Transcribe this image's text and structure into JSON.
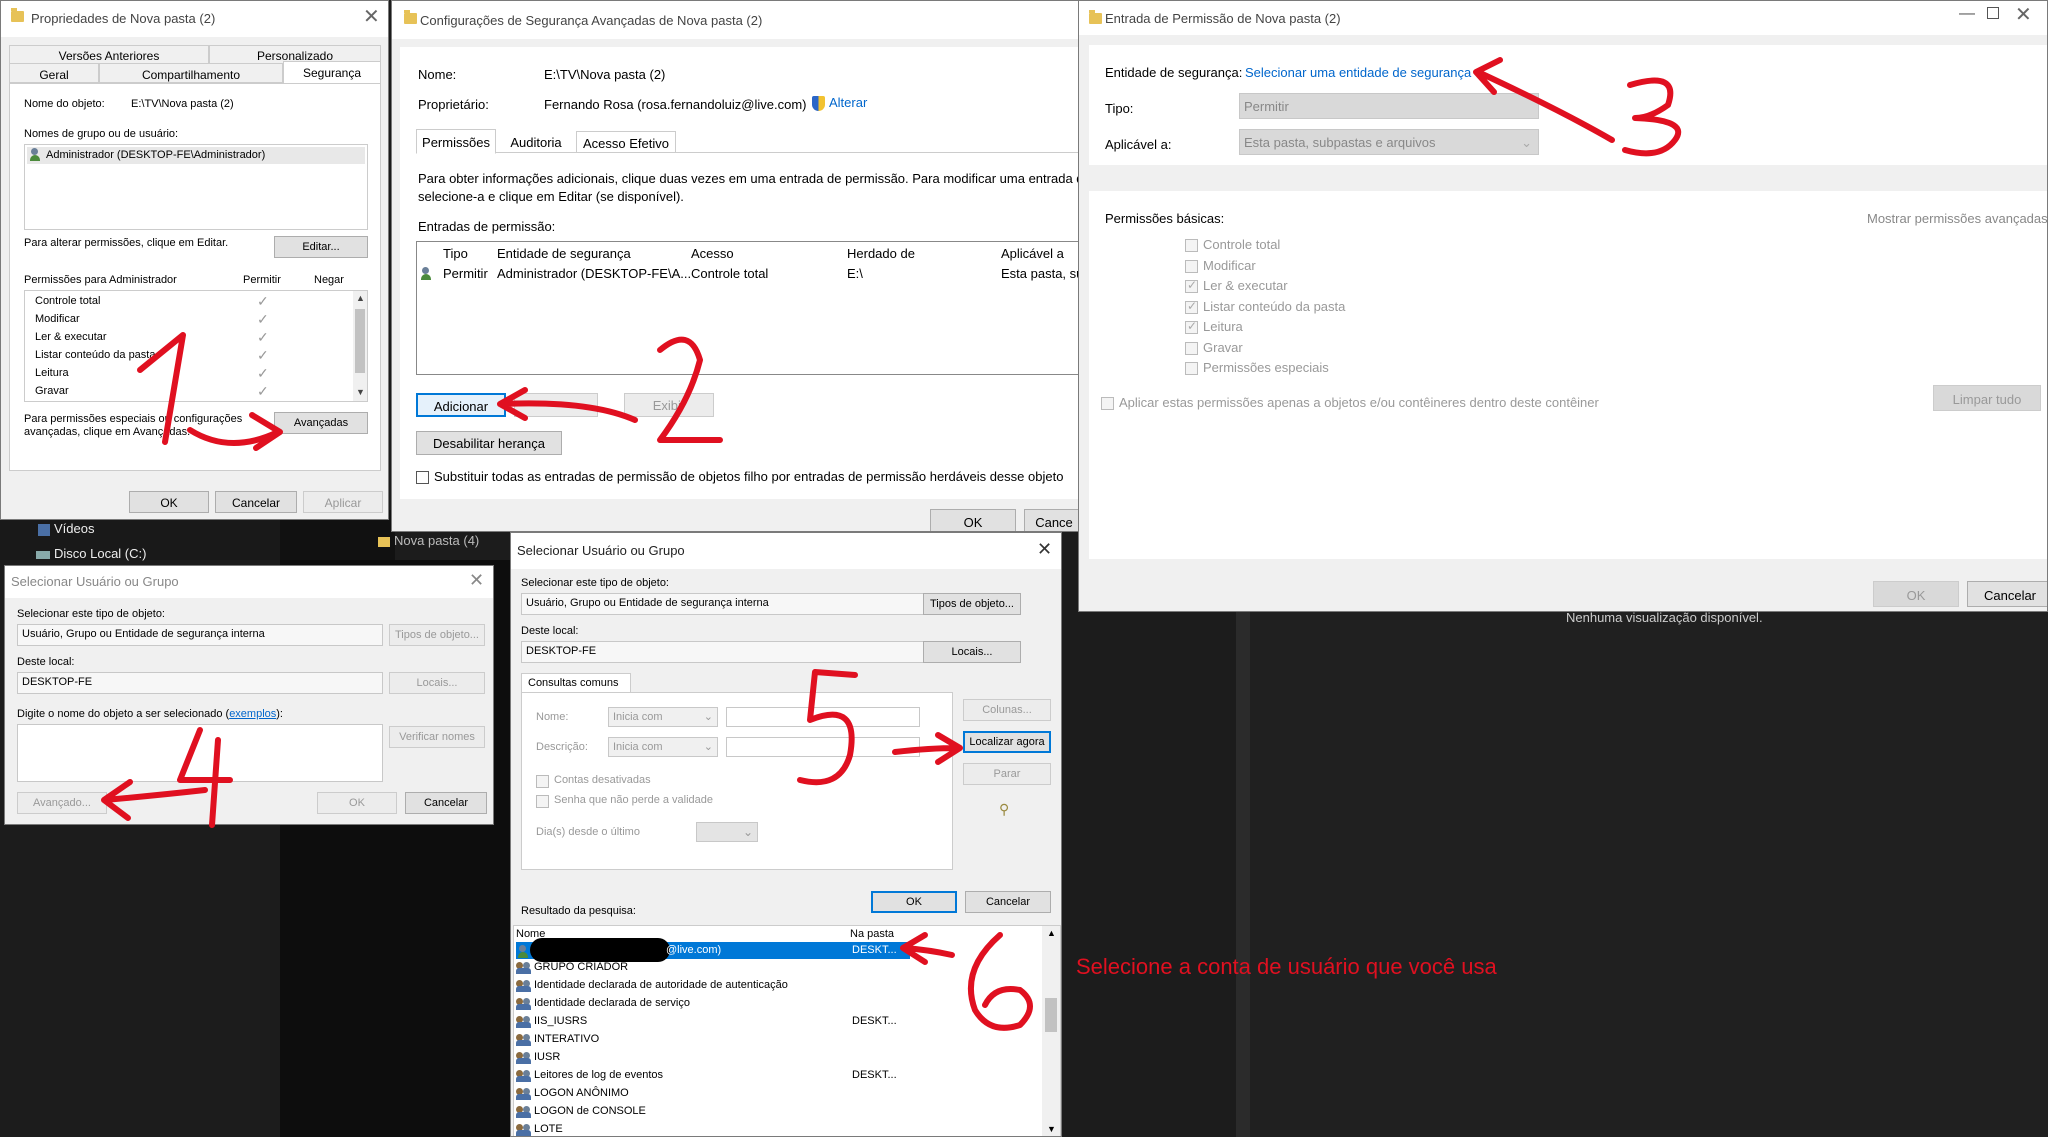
{
  "bg": {
    "videos": "Vídeos",
    "disk": "Disco Local (C:)",
    "folder": "Nova pasta (4)",
    "preview": "Nenhuma visualização disponível."
  },
  "d1": {
    "title": "Propriedades de Nova pasta (2)",
    "tabs_top": [
      "Versões Anteriores",
      "Personalizado"
    ],
    "tabs_bottom": [
      "Geral",
      "Compartilhamento",
      "Segurança"
    ],
    "object_label": "Nome do objeto:",
    "object_value": "E:\\TV\\Nova pasta (2)",
    "groups_label": "Nomes de grupo ou de usuário:",
    "group_item": "Administrador (DESKTOP-FE\\Administrador)",
    "change_text": "Para alterar permissões, clique em Editar.",
    "edit_button": "Editar...",
    "perm_header": "Permissões para Administrador",
    "col_allow": "Permitir",
    "col_deny": "Negar",
    "perms": [
      "Controle total",
      "Modificar",
      "Ler & executar",
      "Listar conteúdo da pasta",
      "Leitura",
      "Gravar"
    ],
    "special_text": "Para permissões especiais ou configurações avançadas, clique em Avançadas.",
    "advanced_button": "Avançadas",
    "ok": "OK",
    "cancel": "Cancelar",
    "apply": "Aplicar"
  },
  "d2": {
    "title": "Configurações de Segurança Avançadas de Nova pasta (2)",
    "name_label": "Nome:",
    "name_value": "E:\\TV\\Nova pasta (2)",
    "owner_label": "Proprietário:",
    "owner_value": "Fernando Rosa (rosa.fernandoluiz@live.com)",
    "change_link": "Alterar",
    "tabs": [
      "Permissões",
      "Auditoria",
      "Acesso Efetivo"
    ],
    "info_text1": "Para obter informações adicionais, clique duas vezes em uma entrada de permissão. Para modificar uma entrada de",
    "info_text2": "selecione-a e clique em Editar (se disponível).",
    "entries_label": "Entradas de permissão:",
    "columns": [
      "Tipo",
      "Entidade de segurança",
      "Acesso",
      "Herdado de",
      "Aplicável a"
    ],
    "row": [
      "Permitir",
      "Administrador (DESKTOP-FE\\A...",
      "Controle total",
      "E:\\",
      "Esta pasta, sub"
    ],
    "add_button": "Adicionar",
    "view_button": "Exibir",
    "disable_button": "Desabilitar herança",
    "replace_text": "Substituir todas as entradas de permissão de objetos filho por entradas de permissão herdáveis desse objeto",
    "ok": "OK",
    "cancel": "Cance"
  },
  "d3": {
    "title": "Entrada de Permissão de Nova pasta (2)",
    "principal_label": "Entidade de segurança:",
    "principal_link": "Selecionar uma entidade de segurança",
    "type_label": "Tipo:",
    "type_value": "Permitir",
    "applies_label": "Aplicável a:",
    "applies_value": "Esta pasta, subpastas e arquivos",
    "basic_label": "Permissões básicas:",
    "advanced_link": "Mostrar permissões avançadas",
    "perms": [
      "Controle total",
      "Modificar",
      "Ler & executar",
      "Listar conteúdo da pasta",
      "Leitura",
      "Gravar",
      "Permissões especiais"
    ],
    "apply_only": "Aplicar estas permissões apenas a objetos e/ou contêineres dentro deste contêiner",
    "clear_all": "Limpar tudo",
    "ok": "OK",
    "cancel": "Cancelar"
  },
  "d4": {
    "title": "Selecionar Usuário ou Grupo",
    "type_label": "Selecionar este tipo de objeto:",
    "type_value": "Usuário, Grupo ou Entidade de segurança interna",
    "types_button": "Tipos de objeto...",
    "loc_label": "Deste local:",
    "loc_value": "DESKTOP-FE",
    "loc_button": "Locais...",
    "enter_label": "Digite o nome do objeto a ser selecionado (",
    "examples_link": "exemplos",
    "enter_label_end": "):",
    "check_button": "Verificar nomes",
    "advanced_button": "Avançado...",
    "ok": "OK",
    "cancel": "Cancelar"
  },
  "d5": {
    "title": "Selecionar Usuário ou Grupo",
    "type_label": "Selecionar este tipo de objeto:",
    "type_value": "Usuário, Grupo ou Entidade de segurança interna",
    "types_button": "Tipos de objeto...",
    "loc_label": "Deste local:",
    "loc_value": "DESKTOP-FE",
    "loc_button": "Locais...",
    "tab": "Consultas comuns",
    "name_label": "Nome:",
    "desc_label": "Descrição:",
    "starts_with": "Inicia com",
    "disabled_accounts": "Contas desativadas",
    "non_expiring": "Senha que não perde a validade",
    "days_label": "Dia(s) desde o último",
    "columns_button": "Colunas...",
    "find_button": "Localizar agora",
    "stop_button": "Parar",
    "ok": "OK",
    "cancel": "Cancelar",
    "results_label": "Resultado da pesquisa:",
    "col_name": "Nome",
    "col_folder": "Na pasta",
    "results": [
      {
        "name": "@live.com)",
        "folder": "DESKT..."
      },
      {
        "name": "GRUPO CRIADOR",
        "folder": ""
      },
      {
        "name": "Identidade declarada de autoridade de autenticação",
        "folder": ""
      },
      {
        "name": "Identidade declarada de serviço",
        "folder": ""
      },
      {
        "name": "IIS_IUSRS",
        "folder": "DESKT..."
      },
      {
        "name": "INTERATIVO",
        "folder": ""
      },
      {
        "name": "IUSR",
        "folder": ""
      },
      {
        "name": "Leitores de log de eventos",
        "folder": "DESKT..."
      },
      {
        "name": "LOGON ANÔNIMO",
        "folder": ""
      },
      {
        "name": "LOGON de CONSOLE",
        "folder": ""
      },
      {
        "name": "LOTE",
        "folder": ""
      }
    ]
  },
  "annotation": {
    "text": "Selecione a conta de usuário que você usa",
    "numbers": [
      "1",
      "2",
      "3",
      "4",
      "5",
      "6"
    ],
    "color": "#e01020"
  }
}
